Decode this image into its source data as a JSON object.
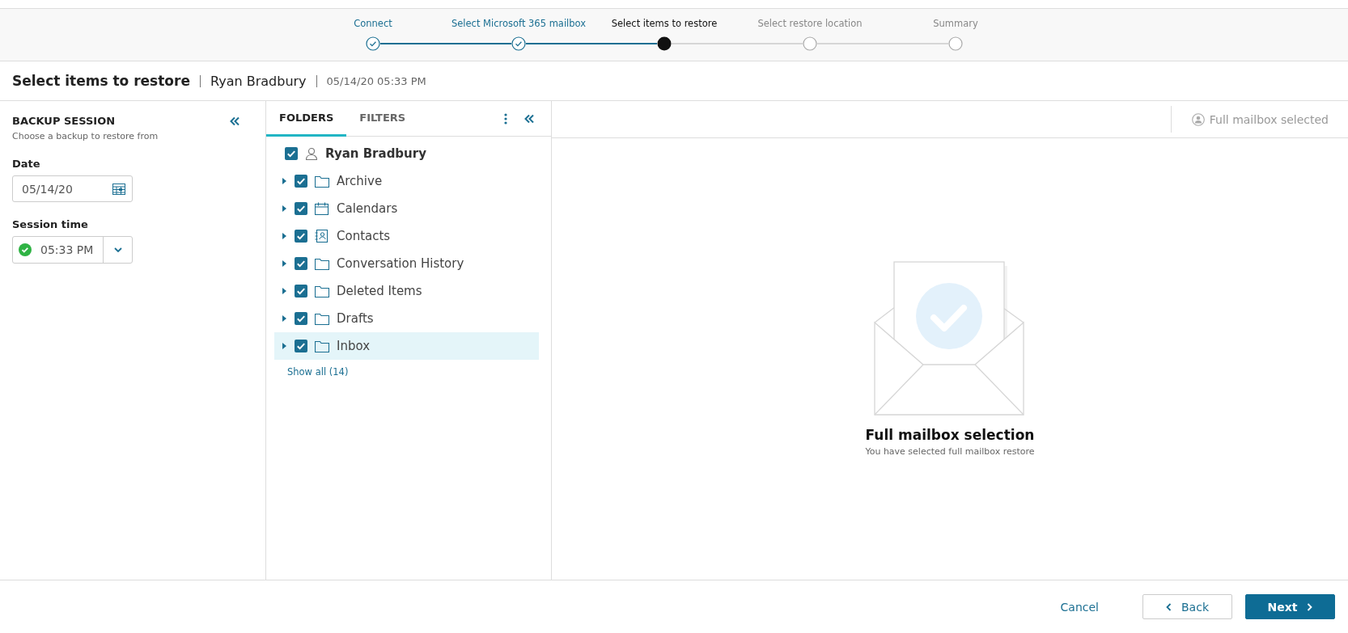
{
  "stepper": [
    {
      "label": "Connect",
      "completed": true,
      "selected": false
    },
    {
      "label": "Select Microsoft 365 mailbox",
      "completed": true,
      "selected": false
    },
    {
      "label": "Select items to restore",
      "completed": false,
      "selected": true
    },
    {
      "label": "Select restore location",
      "completed": false,
      "selected": false
    },
    {
      "label": "Summary",
      "completed": false,
      "selected": false
    }
  ],
  "header": {
    "title": "Select items to restore",
    "mailbox": "Ryan Bradbury",
    "timestamp": "05/14/20 05:33 PM"
  },
  "backup_session": {
    "title": "BACKUP SESSION",
    "subtitle": "Choose a backup to restore from",
    "date_label": "Date",
    "date_value": "05/14/20",
    "time_label": "Session time",
    "time_value": "05:33 PM"
  },
  "tabs": [
    {
      "label": "FOLDERS",
      "selected": true
    },
    {
      "label": "FILTERS",
      "selected": false
    }
  ],
  "tree": {
    "label": "Ryan Bradbury",
    "checked": true,
    "children": [
      {
        "label": "Archive",
        "kind": "folder",
        "checked": true,
        "expanded": false,
        "selected": false
      },
      {
        "label": "Calendars",
        "kind": "calendar",
        "checked": true,
        "expanded": false,
        "selected": false
      },
      {
        "label": "Contacts",
        "kind": "contacts",
        "checked": true,
        "expanded": false,
        "selected": false
      },
      {
        "label": "Conversation History",
        "kind": "folder",
        "checked": true,
        "expanded": false,
        "selected": false
      },
      {
        "label": "Deleted Items",
        "kind": "folder",
        "checked": true,
        "expanded": false,
        "selected": false
      },
      {
        "label": "Drafts",
        "kind": "folder",
        "checked": true,
        "expanded": false,
        "selected": false
      },
      {
        "label": "Inbox",
        "kind": "folder",
        "checked": true,
        "expanded": false,
        "selected": true
      }
    ]
  },
  "show_all": "Show all (14)",
  "status": "Full mailbox selected",
  "empty_state": {
    "title": "Full mailbox selection",
    "subtitle": "You have selected full mailbox restore"
  },
  "footer": {
    "cancel": "Cancel",
    "back": "Back",
    "next": "Next"
  }
}
